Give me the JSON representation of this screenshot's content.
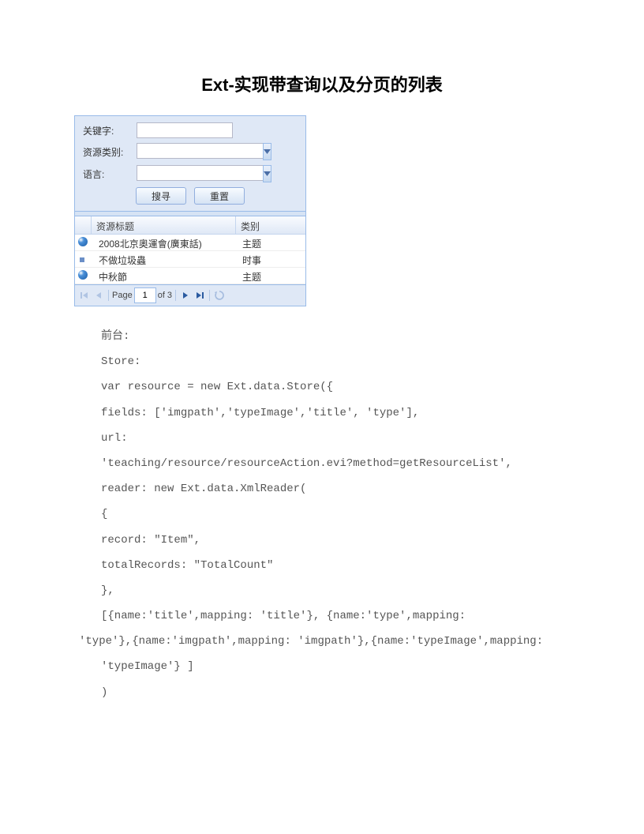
{
  "title": "Ext-实现带查询以及分页的列表",
  "form": {
    "keyword_label": "关键字:",
    "restype_label": "资源类别:",
    "lang_label": "语言:",
    "keyword_value": "",
    "restype_value": "",
    "lang_value": "",
    "search_btn": "搜寻",
    "reset_btn": "重置"
  },
  "grid": {
    "col_title": "资源标题",
    "col_type": "类别",
    "rows": [
      {
        "title": "2008北京奧運會(廣東話)",
        "type": "主题"
      },
      {
        "title": "不做垃圾蟲",
        "type": "时事"
      },
      {
        "title": "中秋節",
        "type": "主题"
      }
    ]
  },
  "pager": {
    "page_label_prefix": "Page",
    "page_value": "1",
    "page_label_suffix": "of 3"
  },
  "code": [
    "前台:",
    "Store:",
    "var resource = new Ext.data.Store({",
    "fields: ['imgpath','typeImage','title', 'type'],",
    "url:",
    "'teaching/resource/resourceAction.evi?method=getResourceList',",
    "reader: new Ext.data.XmlReader(",
    "{",
    "record: \"Item\",",
    "totalRecords: \"TotalCount\"",
    "},",
    "[{name:'title',mapping: 'title'}, {name:'type',mapping:",
    "'type'},{name:'imgpath',mapping: 'imgpath'},{name:'typeImage',mapping:",
    "'typeImage'} ]",
    ")"
  ]
}
